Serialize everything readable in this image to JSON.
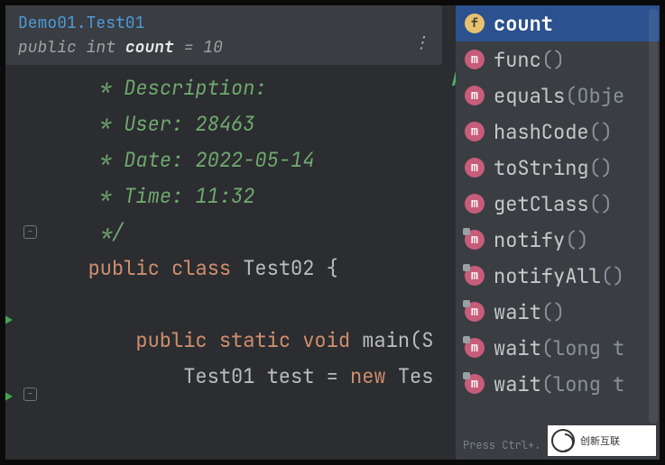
{
  "tooltip": {
    "class_path": "Demo01.Test01",
    "modifiers": "public",
    "type_kw": "int",
    "field_name": "count",
    "eq": "=",
    "value": "10"
  },
  "stray_glyph": "A",
  "code": {
    "lines": [
      {
        "kind": "comment",
        "indent": "    ",
        "text": "* Description:"
      },
      {
        "kind": "comment",
        "indent": "    ",
        "text": "* User: 28463"
      },
      {
        "kind": "comment",
        "indent": "    ",
        "text": "* Date: 2022-05-14"
      },
      {
        "kind": "comment",
        "indent": "    ",
        "text": "* Time: 11:32"
      },
      {
        "kind": "comment",
        "indent": "    ",
        "text": "*/"
      },
      {
        "kind": "class_decl",
        "indent": "   ",
        "kw1": "public",
        "kw2": "class",
        "name": "Test02",
        "brace": "{"
      },
      {
        "kind": "blank",
        "indent": "",
        "text": ""
      },
      {
        "kind": "method_decl",
        "indent": "       ",
        "kw1": "public",
        "kw2": "static",
        "kw3": "void",
        "name": "main",
        "paren": "(",
        "ptype": "S"
      },
      {
        "kind": "stmt",
        "indent": "           ",
        "type": "Test01",
        "var": "test",
        "eq": "=",
        "kw": "new",
        "ctor": "Tes"
      }
    ]
  },
  "completion": {
    "items": [
      {
        "icon": "f",
        "style": "field",
        "label": "count",
        "selected": true,
        "corner": false
      },
      {
        "icon": "m",
        "style": "method",
        "label": "func",
        "parens": "()",
        "corner": false
      },
      {
        "icon": "m",
        "style": "method",
        "label": "equals",
        "parens": "(Obje",
        "corner": false
      },
      {
        "icon": "m",
        "style": "method",
        "label": "hashCode",
        "parens": "()",
        "corner": false
      },
      {
        "icon": "m",
        "style": "method",
        "label": "toString",
        "parens": "()",
        "corner": false
      },
      {
        "icon": "m",
        "style": "method",
        "label": "getClass",
        "parens": "()",
        "corner": false
      },
      {
        "icon": "m",
        "style": "method",
        "label": "notify",
        "parens": "()",
        "corner": true
      },
      {
        "icon": "m",
        "style": "method",
        "label": "notifyAll",
        "parens": "()",
        "corner": true
      },
      {
        "icon": "m",
        "style": "method",
        "label": "wait",
        "parens": "()",
        "corner": true
      },
      {
        "icon": "m",
        "style": "method",
        "label": "wait",
        "parens": "(long t",
        "corner": true
      },
      {
        "icon": "m",
        "style": "method",
        "label": "wait",
        "parens": "(long t",
        "corner": true
      }
    ],
    "hint": "Press Ctrl+. to"
  },
  "logo_text": "创新互联"
}
